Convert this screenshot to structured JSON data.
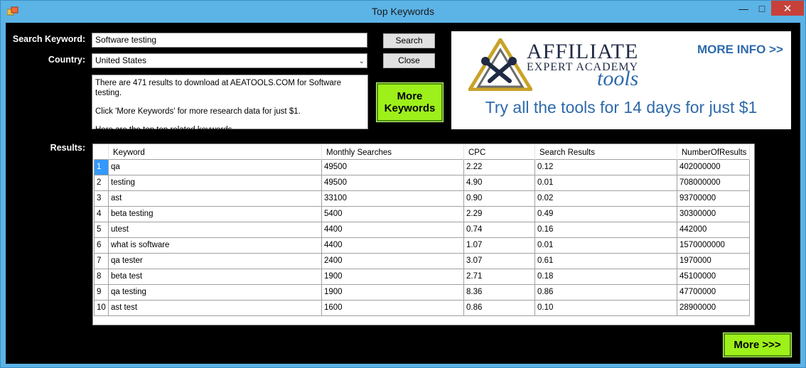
{
  "window": {
    "title": "Top Keywords"
  },
  "form": {
    "search_label": "Search Keyword:",
    "search_value": "Software testing",
    "country_label": "Country:",
    "country_value": "United States",
    "results_label": "Results:",
    "search_button": "Search",
    "close_button": "Close",
    "info_lines": [
      "There are 471 results to download at AEATOOLS.COM for Software testing.",
      "Click 'More Keywords' for more research data for just $1.",
      "Here are the top ten related keywords..."
    ],
    "more_keywords_line1": "More",
    "more_keywords_line2": "Keywords",
    "more_button": "More >>>"
  },
  "ad": {
    "affiliate": "AFFILIATE",
    "academy": "EXPERT ACADEMY",
    "tools": "tools",
    "more_info": "MORE INFO >>",
    "tagline": "Try all the tools for 14 days for just $1",
    "colors": {
      "blue": "#2e6aaa",
      "navy": "#1f2a44",
      "gold": "#c9a227"
    }
  },
  "results": {
    "columns": [
      "Keyword",
      "Monthly Searches",
      "CPC",
      "Search Results",
      "NumberOfResults"
    ],
    "rows": [
      [
        "1",
        "qa",
        "49500",
        "2.22",
        "0.12",
        "402000000"
      ],
      [
        "2",
        "testing",
        "49500",
        "4.90",
        "0.01",
        "708000000"
      ],
      [
        "3",
        "ast",
        "33100",
        "0.90",
        "0.02",
        "93700000"
      ],
      [
        "4",
        "beta testing",
        "5400",
        "2.29",
        "0.49",
        "30300000"
      ],
      [
        "5",
        "utest",
        "4400",
        "0.74",
        "0.16",
        "442000"
      ],
      [
        "6",
        "what is software",
        "4400",
        "1.07",
        "0.01",
        "1570000000"
      ],
      [
        "7",
        "qa tester",
        "2400",
        "3.07",
        "0.61",
        "1970000"
      ],
      [
        "8",
        "beta test",
        "1900",
        "2.71",
        "0.18",
        "45100000"
      ],
      [
        "9",
        "qa testing",
        "1900",
        "8.36",
        "0.86",
        "47700000"
      ],
      [
        "10",
        "ast test",
        "1600",
        "0.86",
        "0.10",
        "28900000"
      ]
    ],
    "selected_row": 0
  },
  "colors": {
    "green_button": "#9ef01a",
    "selection": "#3399ff",
    "titlebar": "#5cb3e6",
    "close_red": "#c7403a"
  }
}
